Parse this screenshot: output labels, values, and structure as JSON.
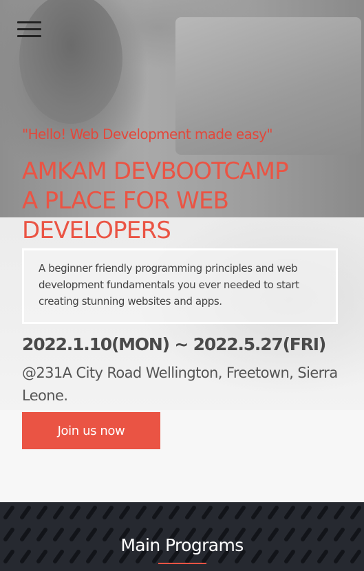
{
  "header": {
    "menu_icon": "hamburger-menu-icon"
  },
  "hero": {
    "tagline": "\"Hello! Web Development made easy\"",
    "title_lines": [
      "AMKAM DEVBOOTCAMP",
      "A PLACE FOR WEB",
      "DEVELOPERS"
    ],
    "description": "A beginner friendly programming principles and web development fundamentals you ever needed to start creating stunning websites and apps.",
    "dates": "2022.1.10(MON) ~ 2022.5.27(FRI)",
    "address": "@231A City Road Wellington, Freetown, Sierra Leone.",
    "cta_label": "Join us now"
  },
  "programs": {
    "title": "Main Programs"
  },
  "colors": {
    "accent": "#ea5444",
    "dark_section": "#262930",
    "text_dark": "#4a4a4a"
  }
}
